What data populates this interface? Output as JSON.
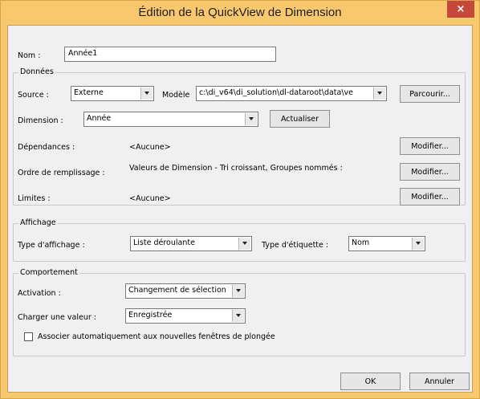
{
  "window": {
    "title": "Édition de la QuickView de Dimension",
    "close_glyph": "×",
    "frame_color": "#f7c86e",
    "close_color": "#c7473a"
  },
  "name": {
    "label": "Nom :",
    "value": "Année1"
  },
  "data_group": {
    "legend": "Données",
    "source_label": "Source :",
    "source_value": "Externe",
    "model_label": "Modèle",
    "model_value": "c:\\di_v64\\di_solution\\dl-dataroot\\data\\ve",
    "browse_button": "Parcourir...",
    "dimension_label": "Dimension :",
    "dimension_value": "Année",
    "refresh_button": "Actualiser",
    "dependencies_label": "Dépendances :",
    "dependencies_value": "<Aucune>",
    "dependencies_button": "Modifier...",
    "fill_order_label": "Ordre de remplissage :",
    "fill_order_value": "Valeurs de Dimension - Tri croissant, Groupes nommés :",
    "fill_order_button": "Modifier...",
    "limits_label": "Limites :",
    "limits_value": "<Aucune>",
    "limits_button": "Modifier..."
  },
  "display_group": {
    "legend": "Affichage",
    "display_type_label": "Type d'affichage :",
    "display_type_value": "Liste déroulante",
    "label_type_label": "Type d'étiquette :",
    "label_type_value": "Nom"
  },
  "behavior_group": {
    "legend": "Comportement",
    "activation_label": "Activation :",
    "activation_value": "Changement de sélection",
    "load_value_label": "Charger une valeur :",
    "load_value_value": "Enregistrée",
    "auto_associate_label": "Associer automatiquement aux nouvelles fenêtres de plongée",
    "auto_associate_checked": false
  },
  "footer": {
    "ok_button": "OK",
    "cancel_button": "Annuler"
  }
}
